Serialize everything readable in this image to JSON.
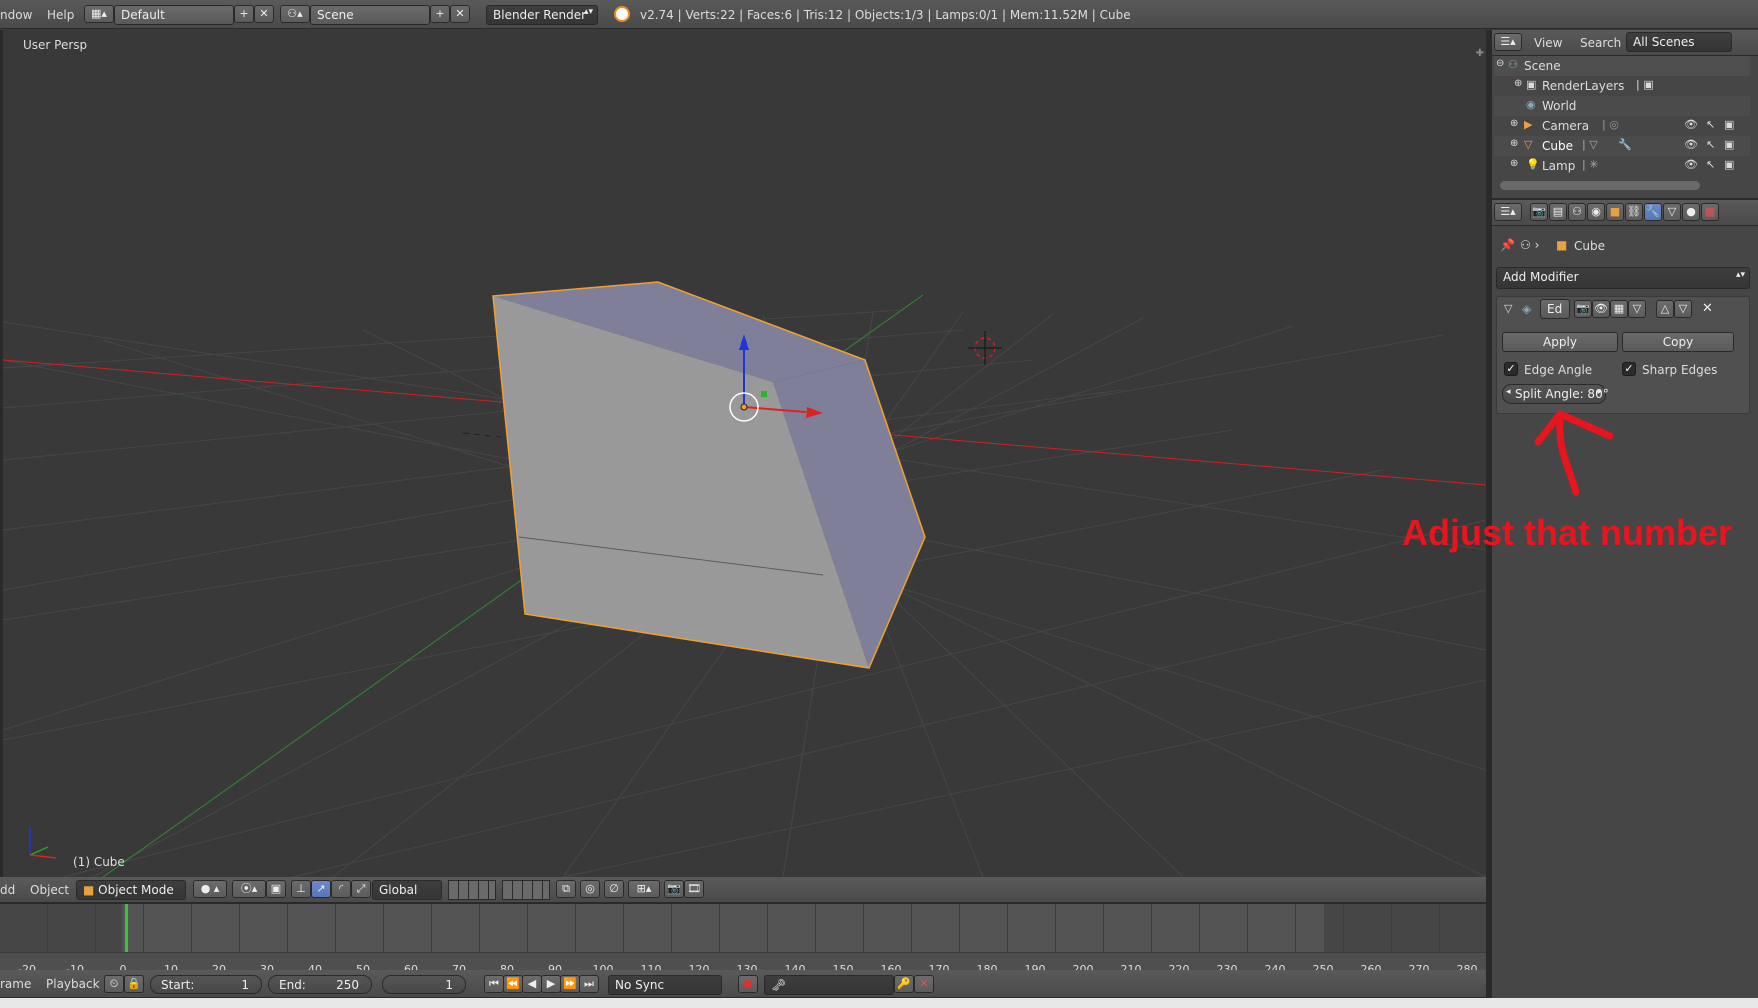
{
  "top_menu": {
    "window_label": "ndow",
    "help_label": "Help",
    "layout_value": "Default",
    "scene_value": "Scene",
    "engine_value": "Blender Render",
    "stats": "v2.74 | Verts:22 | Faces:6 | Tris:12 | Objects:1/3 | Lamps:0/1 | Mem:11.52M | Cube"
  },
  "viewport": {
    "view_label": "User Persp",
    "object_label": "(1) Cube",
    "header": {
      "add_label": "dd",
      "object_menu": "Object",
      "mode_value": "Object Mode",
      "orientation_value": "Global"
    }
  },
  "outliner": {
    "view_label": "View",
    "search_label": "Search",
    "scenes_value": "All Scenes",
    "items": [
      {
        "label": "Scene"
      },
      {
        "label": "RenderLayers"
      },
      {
        "label": "World"
      },
      {
        "label": "Camera"
      },
      {
        "label": "Cube"
      },
      {
        "label": "Lamp"
      }
    ]
  },
  "properties": {
    "breadcrumb_object": "Cube",
    "add_modifier_label": "Add Modifier",
    "modifier": {
      "name_value": "Ed",
      "apply_label": "Apply",
      "copy_label": "Copy",
      "edge_angle_label": "Edge Angle",
      "sharp_edges_label": "Sharp Edges",
      "split_angle_label": "Split Angle: 80°"
    }
  },
  "annotation": {
    "text": "Adjust that number",
    "color": "#e8141e"
  },
  "timeline": {
    "ticks": [
      "-20",
      "-10",
      "0",
      "10",
      "20",
      "30",
      "40",
      "50",
      "60",
      "70",
      "80",
      "90",
      "100",
      "110",
      "120",
      "130",
      "140",
      "150",
      "160",
      "170",
      "180",
      "190",
      "200",
      "210",
      "220",
      "230",
      "240",
      "250",
      "260",
      "270",
      "280"
    ],
    "frame_label": "rame",
    "playback_label": "Playback",
    "start_label": "Start:",
    "start_value": "1",
    "end_label": "End:",
    "end_value": "250",
    "current_value": "1",
    "sync_value": "No Sync"
  },
  "colors": {
    "selection_outline": "#f0a030",
    "face_top": "#7f7f99",
    "face_front": "#999999",
    "x_axis": "#cc2222",
    "y_axis": "#33aa33",
    "z_axis": "#2233dd",
    "active_button": "#5677b8"
  }
}
